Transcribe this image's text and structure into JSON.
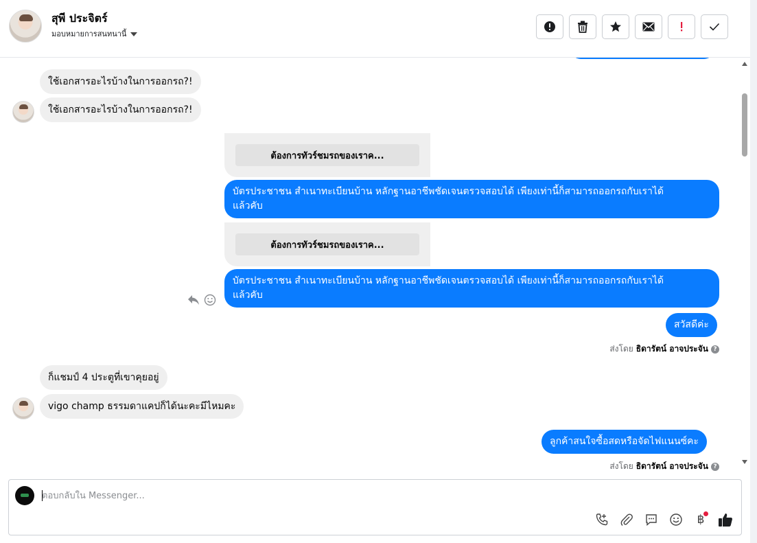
{
  "header": {
    "contact_name": "สุพี ประจิตร์",
    "assign_label": "มอบหมายการสนทนานี้",
    "actions": [
      {
        "icon": "alert-circle-icon"
      },
      {
        "icon": "trash-icon"
      },
      {
        "icon": "star-icon"
      },
      {
        "icon": "envelope-icon"
      },
      {
        "icon": "exclamation-icon",
        "color": "#e41e3f"
      },
      {
        "icon": "check-icon"
      }
    ]
  },
  "messages": {
    "in1": "ใช้เอกสารอะไรบ้างในการออกรถ?!",
    "in2": "ใช้เอกสารอะไรบ้างในการออกรถ?!",
    "card1_button": "ต้องการทัวร์ชมรถของเราค...",
    "out1_line1": "บัตรประชาชน สำเนาทะเบียนบ้าน หลักฐานอาชีพชัดเจนตรวจสอบได้ เพียงเท่านี้ก็สามารถออกรถกับเราได้",
    "out1_line2": "แล้วคับ",
    "card2_button": "ต้องการทัวร์ชมรถของเราค...",
    "out2_line1": "บัตรประชาชน สำเนาทะเบียนบ้าน หลักฐานอาชีพชัดเจนตรวจสอบได้ เพียงเท่านี้ก็สามารถออกรถกับเราได้",
    "out2_line2": "แล้วคับ",
    "out3": "สวัสดีค่ะ",
    "in3": "ก็แชมป์ 4 ประตูที่เขาคุยอยู่",
    "in4": "vigo champ ธรรมดาแคปก็ได้นะคะมีไหมคะ",
    "out4": "ลูกค้าสนใจซื้อสดหรือจัดไฟแนนซ์คะ"
  },
  "sent_by": {
    "prefix": "ส่งโดย",
    "name": "ธิดารัตน์ อาจประจัน",
    "help": "?"
  },
  "composer": {
    "placeholder": "ตอบกลับใน Messenger...",
    "tools": [
      "call-add-icon",
      "paperclip-icon",
      "chat-bubble-icon",
      "emoji-icon",
      "baht-icon",
      "thumbs-up-icon"
    ],
    "baht_symbol": "฿"
  },
  "colors": {
    "accent": "#0a7cff",
    "incoming_bubble": "#efefef",
    "badge_red": "#e41e3f"
  }
}
